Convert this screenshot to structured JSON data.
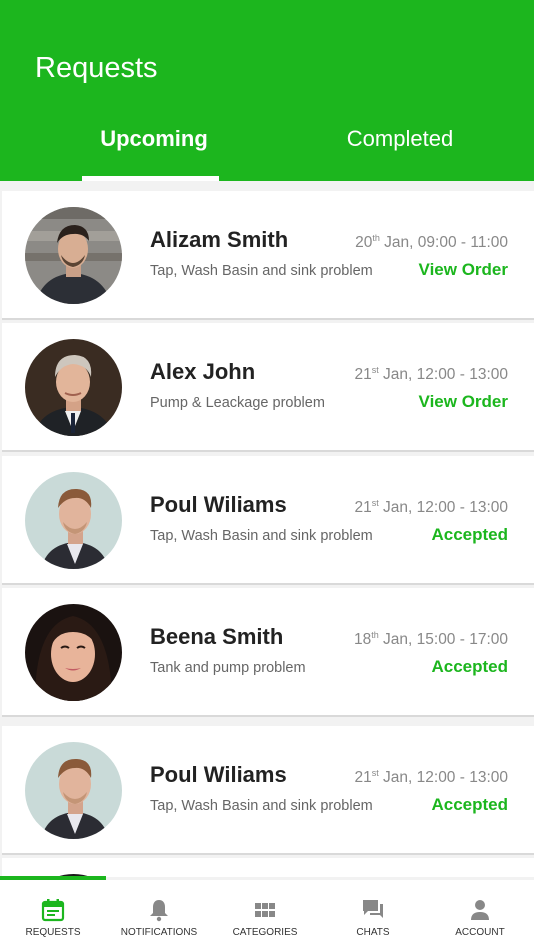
{
  "header": {
    "title": "Requests"
  },
  "tabs": {
    "upcoming": "Upcoming",
    "completed": "Completed"
  },
  "requests": [
    {
      "name": "Alizam Smith",
      "desc": "Tap, Wash Basin and sink problem",
      "day": "20",
      "suffix": "th",
      "time": " Jan, 09:00 - 11:00",
      "action": "View Order"
    },
    {
      "name": "Alex John",
      "desc": "Pump & Leackage problem",
      "day": "21",
      "suffix": "st",
      "time": " Jan, 12:00 - 13:00",
      "action": "View Order"
    },
    {
      "name": "Poul Wiliams",
      "desc": "Tap, Wash Basin and sink problem",
      "day": "21",
      "suffix": "st",
      "time": " Jan, 12:00 - 13:00",
      "action": "Accepted"
    },
    {
      "name": "Beena Smith",
      "desc": "Tank and pump problem",
      "day": "18",
      "suffix": "th",
      "time": " Jan, 15:00 - 17:00",
      "action": "Accepted"
    },
    {
      "name": "Poul Wiliams",
      "desc": "Tap, Wash Basin and sink problem",
      "day": "21",
      "suffix": "st",
      "time": " Jan, 12:00 - 13:00",
      "action": "Accepted"
    }
  ],
  "nav": {
    "requests": "REQUESTS",
    "notifications": "NOTIFICATIONS",
    "categories": "CATEGORIES",
    "chats": "CHATS",
    "account": "ACCOUNT"
  },
  "colors": {
    "accent": "#1cb61e"
  }
}
